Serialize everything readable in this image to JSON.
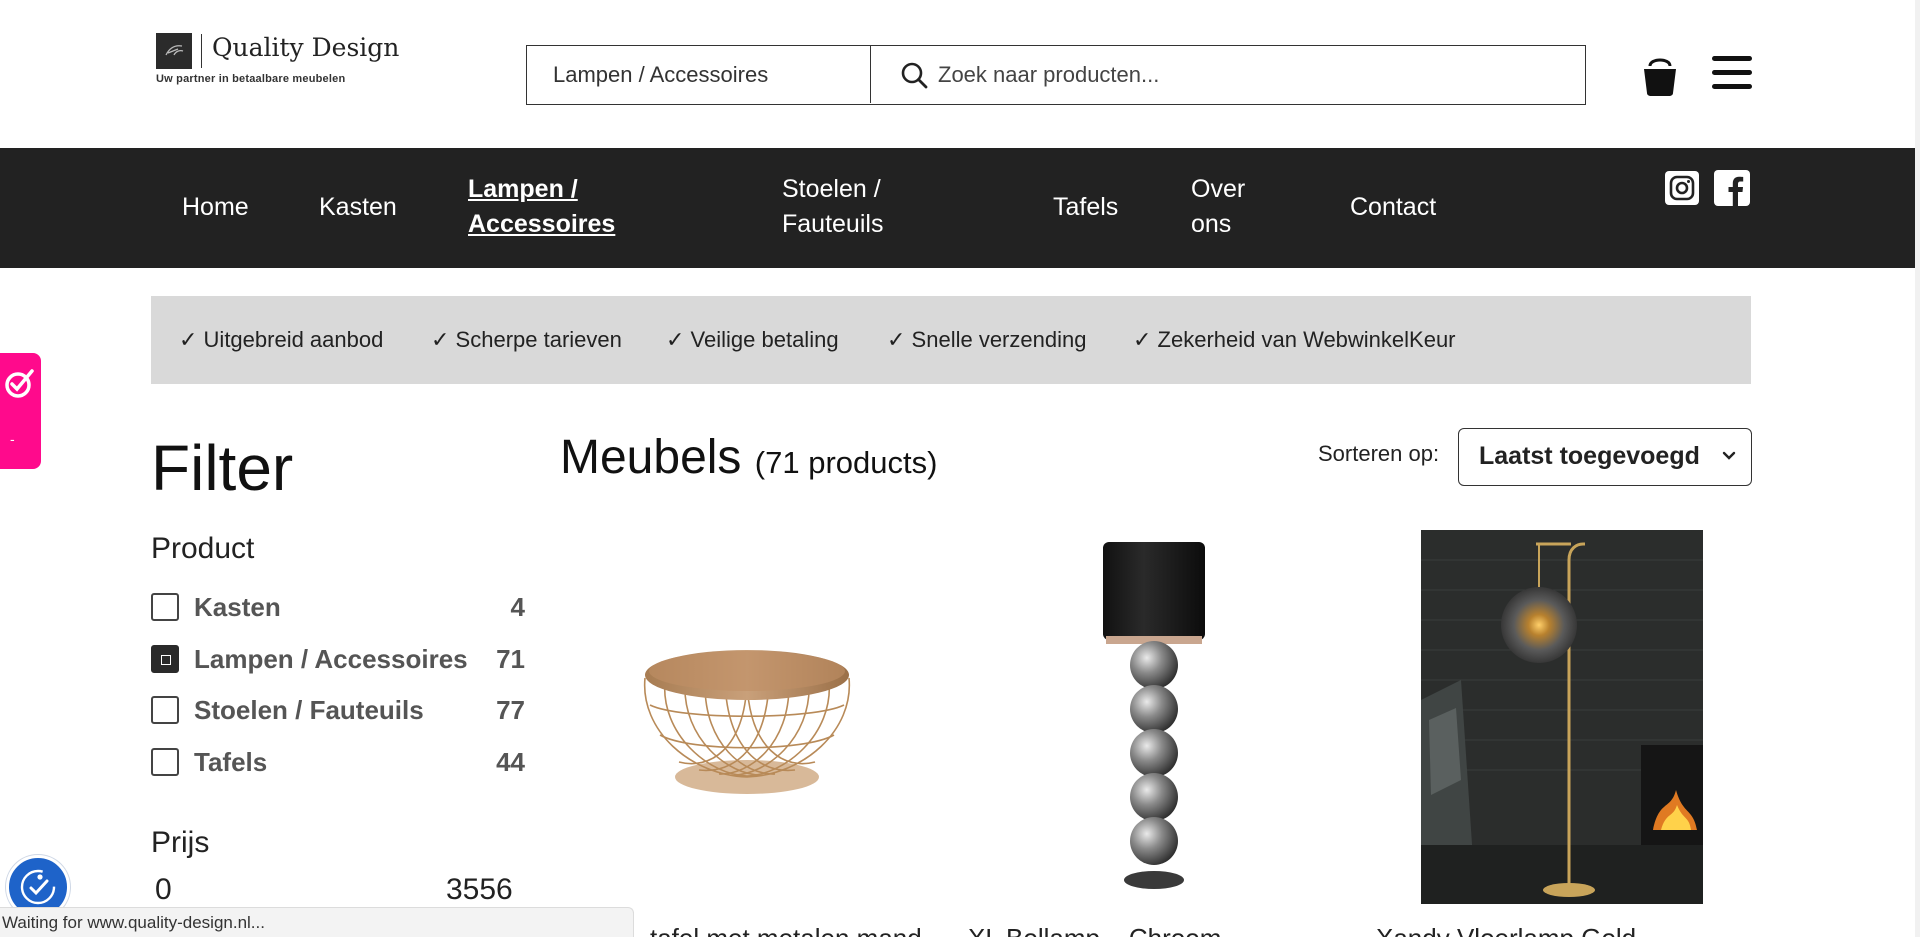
{
  "header": {
    "logo_name": "Quality Design",
    "logo_tagline": "Uw partner in betaalbare meubelen",
    "search_category": "Lampen / Accessoires",
    "search_placeholder": "Zoek naar producten..."
  },
  "nav": {
    "items": [
      {
        "label": "Home"
      },
      {
        "label": "Kasten"
      },
      {
        "label_line1": "Lampen /",
        "label_line2": "Accessoires",
        "active": true
      },
      {
        "label_line1": "Stoelen /",
        "label_line2": "Fauteuils"
      },
      {
        "label": "Tafels"
      },
      {
        "label_line1": "Over",
        "label_line2": "ons"
      },
      {
        "label": "Contact"
      }
    ]
  },
  "usp": [
    "✓ Uitgebreid aanbod",
    "✓ Scherpe tarieven",
    "✓ Veilige betaling",
    "✓ Snelle verzending",
    "✓ Zekerheid van WebwinkelKeur"
  ],
  "filter": {
    "title": "Filter",
    "product_section": "Product",
    "options": [
      {
        "label": "Kasten",
        "count": "4",
        "checked": false
      },
      {
        "label": "Lampen / Accessoires",
        "count": "71",
        "checked": true
      },
      {
        "label": "Stoelen / Fauteuils",
        "count": "77",
        "checked": false
      },
      {
        "label": "Tafels",
        "count": "44",
        "checked": false
      }
    ],
    "price_section": "Prijs",
    "price_min": "0",
    "price_max": "3556"
  },
  "products": {
    "title": "Meubels",
    "count_text": "(71 products)",
    "sort_label": "Sorteren op:",
    "sort_value": "Laatst toegevoegd",
    "items": [
      {
        "name": "…tafel met metalen mand",
        "image": "wire-basket-table"
      },
      {
        "name": "XL Bollamp – Chroom",
        "image": "chrome-ball-lamp"
      },
      {
        "name": "Xandy Vloerlamp Gold",
        "image": "gold-floor-lamp"
      }
    ]
  },
  "status_bar": "Waiting for www.quality-design.nl...",
  "colors": {
    "nav_bg": "#222222",
    "usp_bg": "#d9d9d9",
    "badge_pink": "#ff0a8c",
    "accessibility_blue": "#1e63c9"
  }
}
